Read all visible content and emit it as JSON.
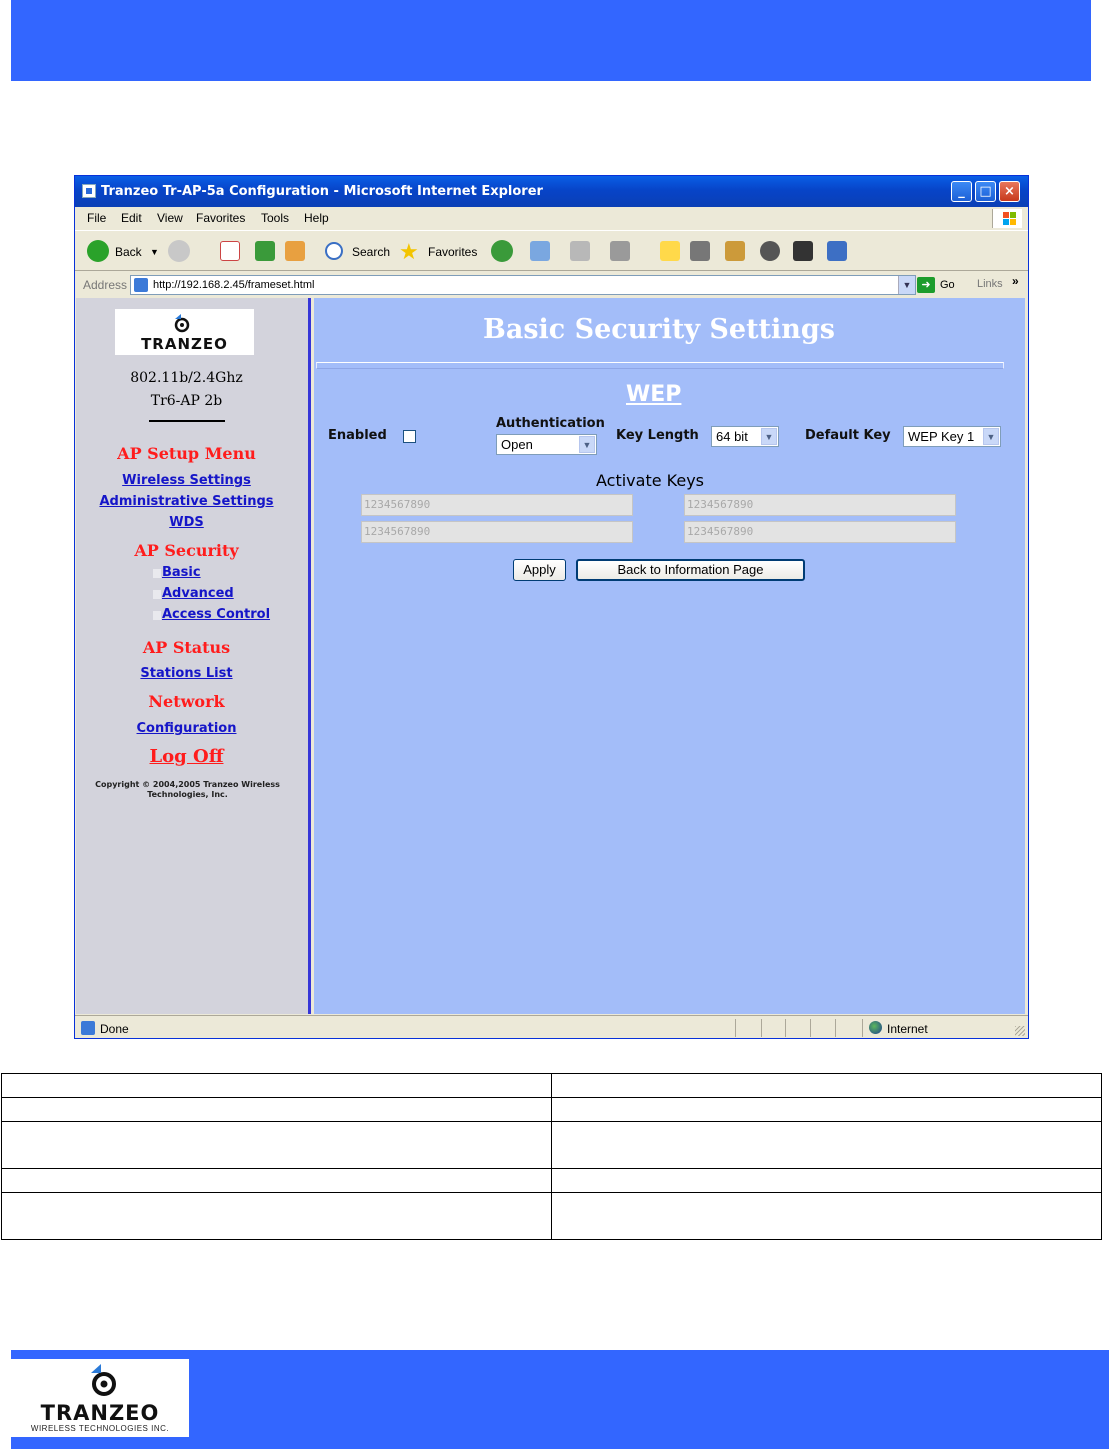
{
  "window": {
    "title": "Tranzeo Tr-AP-5a Configuration - Microsoft Internet Explorer"
  },
  "menu": [
    "File",
    "Edit",
    "View",
    "Favorites",
    "Tools",
    "Help"
  ],
  "toolbar": {
    "back": "Back",
    "search": "Search",
    "favorites": "Favorites"
  },
  "address": {
    "label": "Address",
    "url": "http://192.168.2.45/frameset.html",
    "go": "Go",
    "links": "Links"
  },
  "sidebar": {
    "logo_text": "TRANZEO",
    "model_line1": "802.11b/2.4Ghz",
    "model_line2": "Tr6-AP 2b",
    "setup_heading": "AP Setup Menu",
    "setup_links": [
      "Wireless Settings",
      "Administrative Settings",
      "WDS"
    ],
    "security_heading": "AP Security",
    "security_links": [
      "Basic",
      "Advanced",
      "Access Control"
    ],
    "status_heading": "AP Status",
    "status_link": "Stations List",
    "network_heading": "Network",
    "network_link": "Configuration",
    "logoff": "Log Off",
    "copyright": "Copyright © 2004,2005 Tranzeo Wireless Technologies, Inc."
  },
  "main": {
    "title": "Basic Security Settings",
    "section": "WEP",
    "enabled_label": "Enabled",
    "enabled_checked": false,
    "auth_label": "Authentication",
    "auth_value": "Open",
    "key_length_label": "Key Length",
    "key_length_value": "64 bit",
    "default_key_label": "Default Key",
    "default_key_value": "WEP Key 1",
    "activate_keys_label": "Activate Keys",
    "keys": [
      "1234567890",
      "1234567890",
      "1234567890",
      "1234567890"
    ],
    "apply_button": "Apply",
    "back_button": "Back to Information Page"
  },
  "status": {
    "text": "Done",
    "zone": "Internet"
  },
  "footer": {
    "logo_text": "TRANZEO",
    "logo_sub": "WIRELESS TECHNOLOGIES INC."
  },
  "colors": {
    "band": "#3366ff",
    "content_bg": "#a3bdf9",
    "sidebar_bg": "#d3d3dc",
    "heading_red": "#ff1c1c",
    "link_blue": "#1515c8"
  }
}
